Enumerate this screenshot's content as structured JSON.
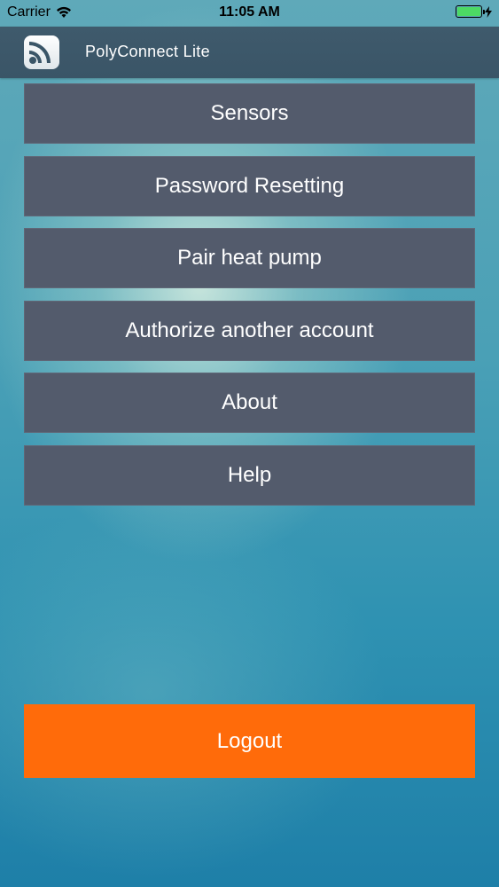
{
  "status_bar": {
    "carrier": "Carrier",
    "wifi_icon": "wifi-icon",
    "time": "11:05 AM",
    "battery_icon": "battery-icon",
    "battery_level": 1.0,
    "charging_icon": "bolt-icon"
  },
  "header": {
    "logo_icon": "rss-feed-icon",
    "title": "PolyConnect Lite"
  },
  "menu": {
    "items": [
      {
        "label": "Sensors"
      },
      {
        "label": "Password Resetting"
      },
      {
        "label": "Pair heat pump"
      },
      {
        "label": "Authorize another account"
      },
      {
        "label": "About"
      },
      {
        "label": "Help"
      }
    ]
  },
  "logout": {
    "label": "Logout"
  },
  "colors": {
    "menu_button": "#535b6c",
    "header": "#3d586a",
    "logout": "#ff6b0a",
    "battery": "#4cd964"
  }
}
